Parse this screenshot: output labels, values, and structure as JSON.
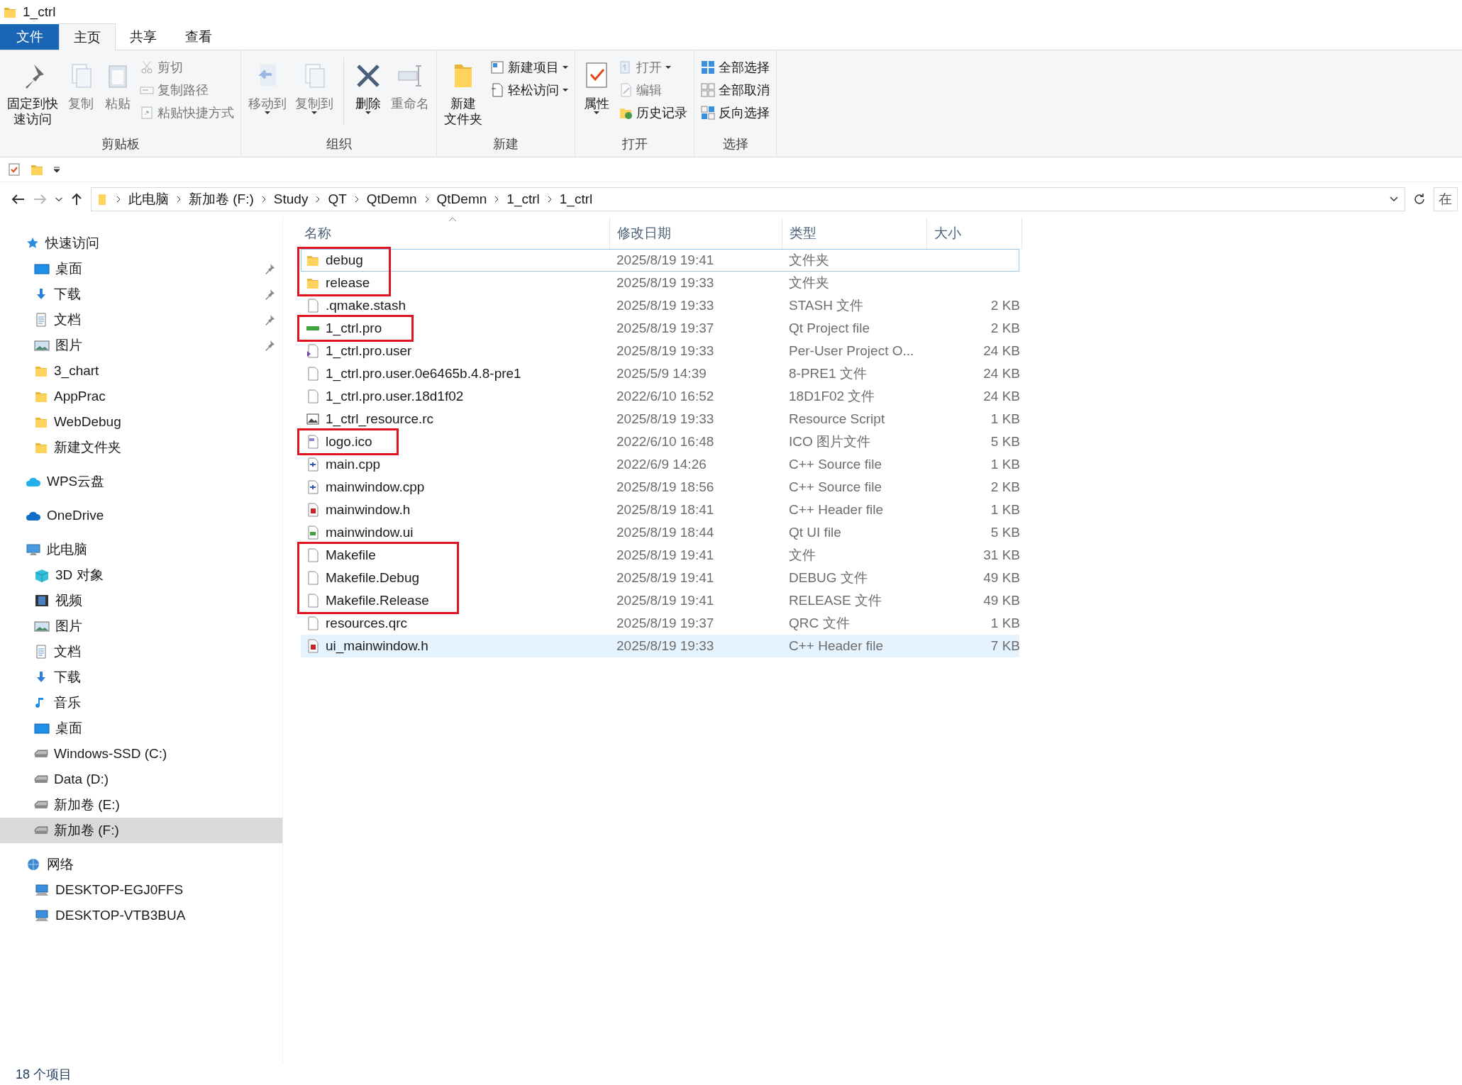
{
  "window": {
    "title": "1_ctrl"
  },
  "ribbon": {
    "tabs": [
      {
        "label": "文件",
        "kind": "file",
        "selected": false
      },
      {
        "label": "主页",
        "kind": "tab",
        "selected": true
      },
      {
        "label": "共享",
        "kind": "tab",
        "selected": false
      },
      {
        "label": "查看",
        "kind": "tab",
        "selected": false
      }
    ],
    "groups": [
      {
        "title": "剪贴板",
        "items": [
          {
            "kind": "large",
            "lines": [
              "固定到快",
              "速访问"
            ],
            "disabled": false,
            "dropdown": false
          },
          {
            "kind": "large",
            "lines": [
              "复制"
            ],
            "disabled": true,
            "dropdown": false
          },
          {
            "kind": "large",
            "lines": [
              "粘贴"
            ],
            "disabled": true,
            "dropdown": false
          },
          {
            "kind": "stack",
            "items": [
              {
                "label": "剪切",
                "disabled": true,
                "dropdown": false
              },
              {
                "label": "复制路径",
                "disabled": true,
                "dropdown": false
              },
              {
                "label": "粘贴快捷方式",
                "disabled": true,
                "dropdown": false
              }
            ]
          }
        ]
      },
      {
        "title": "组织",
        "items": [
          {
            "kind": "large",
            "lines": [
              "移动到"
            ],
            "disabled": true,
            "dropdown": true
          },
          {
            "kind": "large",
            "lines": [
              "复制到"
            ],
            "disabled": true,
            "dropdown": true
          },
          {
            "kind": "separator"
          },
          {
            "kind": "large",
            "lines": [
              "删除"
            ],
            "disabled": false,
            "dropdown": true
          },
          {
            "kind": "large",
            "lines": [
              "重命名"
            ],
            "disabled": true,
            "dropdown": false
          }
        ]
      },
      {
        "title": "新建",
        "items": [
          {
            "kind": "large",
            "lines": [
              "新建",
              "文件夹"
            ],
            "disabled": false,
            "dropdown": false
          },
          {
            "kind": "stack",
            "items": [
              {
                "label": "新建项目",
                "disabled": false,
                "dropdown": true
              },
              {
                "label": "轻松访问",
                "disabled": false,
                "dropdown": true
              }
            ]
          }
        ]
      },
      {
        "title": "打开",
        "items": [
          {
            "kind": "large",
            "lines": [
              "属性"
            ],
            "disabled": false,
            "dropdown": true
          },
          {
            "kind": "stack",
            "items": [
              {
                "label": "打开",
                "disabled": true,
                "dropdown": true
              },
              {
                "label": "编辑",
                "disabled": true,
                "dropdown": false
              },
              {
                "label": "历史记录",
                "disabled": false,
                "dropdown": false
              }
            ]
          }
        ]
      },
      {
        "title": "选择",
        "items": [
          {
            "kind": "stack",
            "items": [
              {
                "label": "全部选择",
                "disabled": false,
                "dropdown": false
              },
              {
                "label": "全部取消",
                "disabled": false,
                "dropdown": false
              },
              {
                "label": "反向选择",
                "disabled": false,
                "dropdown": false
              }
            ]
          }
        ]
      }
    ]
  },
  "address": {
    "back_disabled": false,
    "forward_disabled": true,
    "crumbs": [
      "此电脑",
      "新加卷 (F:)",
      "Study",
      "QT",
      "QtDemn",
      "QtDemn",
      "1_ctrl",
      "1_ctrl"
    ],
    "search": {
      "placeholder": "在"
    }
  },
  "sidebar": {
    "items": [
      {
        "label": "快速访问",
        "kind": "star",
        "selected": false,
        "children": [
          {
            "label": "桌面",
            "kind": "desktop",
            "pinned": true,
            "selected": false
          },
          {
            "label": "下载",
            "kind": "download",
            "pinned": true,
            "selected": false
          },
          {
            "label": "文档",
            "kind": "doc",
            "pinned": true,
            "selected": false
          },
          {
            "label": "图片",
            "kind": "picture",
            "pinned": true,
            "selected": false
          },
          {
            "label": "3_chart",
            "kind": "folder",
            "pinned": false,
            "selected": false
          },
          {
            "label": "AppPrac",
            "kind": "folder",
            "pinned": false,
            "selected": false
          },
          {
            "label": "WebDebug",
            "kind": "folder",
            "pinned": false,
            "selected": false
          },
          {
            "label": "新建文件夹",
            "kind": "folder",
            "pinned": false,
            "selected": false
          }
        ]
      },
      {
        "label": "WPS云盘",
        "kind": "cloud",
        "selected": false
      },
      {
        "label": "OneDrive",
        "kind": "onedrive",
        "selected": false
      },
      {
        "label": "此电脑",
        "kind": "pc",
        "selected": false,
        "children": [
          {
            "label": "3D 对象",
            "kind": "cube",
            "selected": false
          },
          {
            "label": "视频",
            "kind": "video",
            "selected": false
          },
          {
            "label": "图片",
            "kind": "picture",
            "selected": false
          },
          {
            "label": "文档",
            "kind": "doc",
            "selected": false
          },
          {
            "label": "下载",
            "kind": "download",
            "selected": false
          },
          {
            "label": "音乐",
            "kind": "music",
            "selected": false
          },
          {
            "label": "桌面",
            "kind": "desktop",
            "selected": false
          },
          {
            "label": "Windows-SSD (C:)",
            "kind": "drive",
            "selected": false
          },
          {
            "label": "Data (D:)",
            "kind": "drive",
            "selected": false
          },
          {
            "label": "新加卷 (E:)",
            "kind": "drive",
            "selected": false
          },
          {
            "label": "新加卷 (F:)",
            "kind": "drive",
            "selected": true
          }
        ]
      },
      {
        "label": "网络",
        "kind": "network",
        "selected": false,
        "children": [
          {
            "label": "DESKTOP-EGJ0FFS",
            "kind": "computer",
            "selected": false
          },
          {
            "label": "DESKTOP-VTB3BUA",
            "kind": "computer",
            "selected": false
          }
        ]
      }
    ]
  },
  "table": {
    "columns": [
      "名称",
      "修改日期",
      "类型",
      "大小"
    ],
    "rows": [
      {
        "name": "debug",
        "kind": "folder",
        "date": "2025/8/19 19:41",
        "type": "文件夹",
        "selected": false,
        "focused": true,
        "marked": true
      },
      {
        "name": "release",
        "kind": "folder",
        "date": "2025/8/19 19:33",
        "type": "文件夹",
        "selected": false,
        "focused": false,
        "marked": true
      },
      {
        "name": ".qmake.stash",
        "kind": "blank",
        "date": "2025/8/19 19:33",
        "type": "STASH 文件",
        "size": "2 KB",
        "selected": false,
        "focused": false,
        "marked": false
      },
      {
        "name": "1_ctrl.pro",
        "kind": "pro",
        "date": "2025/8/19 19:37",
        "type": "Qt Project file",
        "size": "2 KB",
        "selected": false,
        "focused": false,
        "marked": true
      },
      {
        "name": "1_ctrl.pro.user",
        "kind": "user",
        "date": "2025/8/19 19:33",
        "type": "Per-User Project O...",
        "size": "24 KB",
        "selected": false,
        "focused": false,
        "marked": false
      },
      {
        "name": "1_ctrl.pro.user.0e6465b.4.8-pre1",
        "kind": "blank",
        "date": "2025/5/9 14:39",
        "type": "8-PRE1 文件",
        "size": "24 KB",
        "selected": false,
        "focused": false,
        "marked": false
      },
      {
        "name": "1_ctrl.pro.user.18d1f02",
        "kind": "blank",
        "date": "2022/6/10 16:52",
        "type": "18D1F02 文件",
        "size": "24 KB",
        "selected": false,
        "focused": false,
        "marked": false
      },
      {
        "name": "1_ctrl_resource.rc",
        "kind": "rc",
        "date": "2025/8/19 19:33",
        "type": "Resource Script",
        "size": "1 KB",
        "selected": false,
        "focused": false,
        "marked": false
      },
      {
        "name": "logo.ico",
        "kind": "ico",
        "date": "2022/6/10 16:48",
        "type": "ICO 图片文件",
        "size": "5 KB",
        "selected": false,
        "focused": false,
        "marked": true
      },
      {
        "name": "main.cpp",
        "kind": "cpp",
        "date": "2022/6/9 14:26",
        "type": "C++ Source file",
        "size": "1 KB",
        "selected": false,
        "focused": false,
        "marked": false
      },
      {
        "name": "mainwindow.cpp",
        "kind": "cpp",
        "date": "2025/8/19 18:56",
        "type": "C++ Source file",
        "size": "2 KB",
        "selected": false,
        "focused": false,
        "marked": false
      },
      {
        "name": "mainwindow.h",
        "kind": "h",
        "date": "2025/8/19 18:41",
        "type": "C++ Header file",
        "size": "1 KB",
        "selected": false,
        "focused": false,
        "marked": false
      },
      {
        "name": "mainwindow.ui",
        "kind": "ui",
        "date": "2025/8/19 18:44",
        "type": "Qt UI file",
        "size": "5 KB",
        "selected": false,
        "focused": false,
        "marked": false
      },
      {
        "name": "Makefile",
        "kind": "blank",
        "date": "2025/8/19 19:41",
        "type": "文件",
        "size": "31 KB",
        "selected": false,
        "focused": false,
        "marked": true
      },
      {
        "name": "Makefile.Debug",
        "kind": "blank",
        "date": "2025/8/19 19:41",
        "type": "DEBUG 文件",
        "size": "49 KB",
        "selected": false,
        "focused": false,
        "marked": true
      },
      {
        "name": "Makefile.Release",
        "kind": "blank",
        "date": "2025/8/19 19:41",
        "type": "RELEASE 文件",
        "size": "49 KB",
        "selected": false,
        "focused": false,
        "marked": true
      },
      {
        "name": "resources.qrc",
        "kind": "blank",
        "date": "2025/8/19 19:37",
        "type": "QRC 文件",
        "size": "1 KB",
        "selected": false,
        "focused": false,
        "marked": false
      },
      {
        "name": "ui_mainwindow.h",
        "kind": "h",
        "date": "2025/8/19 19:33",
        "type": "C++ Header file",
        "size": "7 KB",
        "selected": true,
        "focused": false,
        "marked": false
      }
    ]
  },
  "status_bar": {
    "count": "18 个项目"
  }
}
